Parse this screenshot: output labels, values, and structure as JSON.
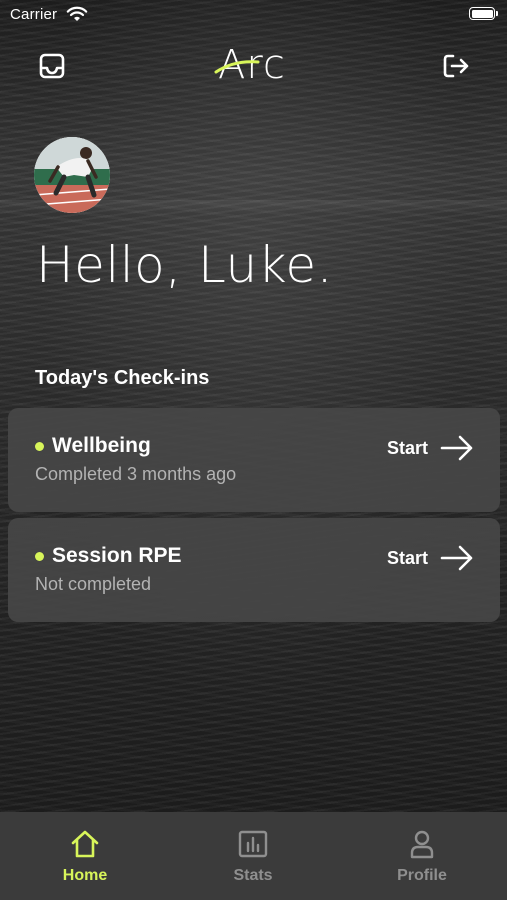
{
  "status_bar": {
    "carrier": "Carrier"
  },
  "header": {
    "logo_text": "Arc"
  },
  "greeting": "Hello, Luke.",
  "checkins": {
    "title": "Today's Check-ins",
    "items": [
      {
        "title": "Wellbeing",
        "status": "Completed 3 months ago",
        "action": "Start"
      },
      {
        "title": "Session RPE",
        "status": "Not completed",
        "action": "Start"
      }
    ]
  },
  "tabs": [
    {
      "label": "Home",
      "active": true
    },
    {
      "label": "Stats",
      "active": false
    },
    {
      "label": "Profile",
      "active": false
    }
  ],
  "colors": {
    "accent": "#d8f55a",
    "card": "#464646",
    "tabbar": "#3b3b3b",
    "muted": "#8f8f8f"
  }
}
